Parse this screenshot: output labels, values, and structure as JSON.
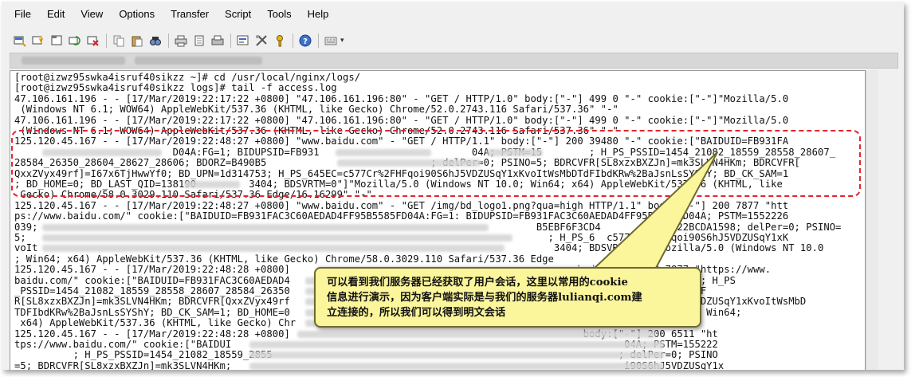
{
  "menu": {
    "file": "File",
    "edit": "Edit",
    "view": "View",
    "options": "Options",
    "transfer": "Transfer",
    "script": "Script",
    "tools": "Tools",
    "help": "Help"
  },
  "toolbar": {
    "icons": [
      "connect-icon",
      "quick-connect-icon",
      "connect-tab-icon",
      "reconnect-icon",
      "disconnect-icon",
      "copy-icon",
      "paste-icon",
      "find-icon",
      "print-setup-icon",
      "print-icon",
      "print-screen-icon",
      "session-options-icon",
      "global-options-icon",
      "key-map-icon",
      "help-icon",
      "map-keys-icon"
    ]
  },
  "terminal": {
    "lines": [
      "[root@izwz95swka4isruf40sikzz ~]# cd /usr/local/nginx/logs/",
      "[root@izwz95swka4isruf40sikzz logs]# tail -f access.log",
      "47.106.161.196 - - [17/Mar/2019:22:17:22 +0800] \"47.106.161.196:80\" - \"GET / HTTP/1.0\" body:[\"-\"] 499 0 \"-\" cookie:[\"-\"]\"Mozilla/5.0",
      " (Windows NT 6.1; WOW64) AppleWebKit/537.36 (KHTML, like Gecko) Chrome/52.0.2743.116 Safari/537.36\" \"-\"",
      "47.106.161.196 - - [17/Mar/2019:22:17:22 +0800] \"47.106.161.196:80\" - \"GET / HTTP/1.0\" body:[\"-\"] 499 0 \"-\" cookie:[\"-\"]\"Mozilla/5.0",
      " (Windows NT 6.1; WOW64) AppleWebKit/537.36 (KHTML, like Gecko) Chrome/52.0.2743.116 Safari/537.36\" \"-\"",
      "125.120.45.167 - - [17/Mar/2019:22:48:27 +0800] \"www.baidu.com\" - \"GET / HTTP/1.1\" body:[\"-\"] 200 39480 \"-\" cookie:[\"BAIDUID=FB931FA",
      "                           D04A:FG=1; BIDUPSID=FB931                          04A; PSTM=15        ; H_PS_PSSID=1454_21082_18559_28558_28607_",
      "28584_26350_28604_28627_28606; BDORZ=B490B5                            ; delPer=0; PSINO=5; BDRCVFR[SL8xzxBXZJn]=mk3SLVN4HKm; BDRCVFR[",
      "QxxZVyx49rf]=I67x6TjHwwYf0; BD_UPN=1d314753; H_PS_645EC=c577Cr%2FHFqoi90S6hJ5VDZUSqY1xKvoItWsMbDTdFIbdKRw%2BaJsnLsSYShY; BD_CK_SAM=1",
      "; BD_HOME=0; BD_LAST_QID=138190         3404; BDSVRTM=0\"]\"Mozilla/5.0 (Windows NT 10.0; Win64; x64) AppleWebKit/537.36 (KHTML, like",
      " Gecko) Chrome/58.0.3029.110 Safari/537.36 Edge/16.16299\" \"-\"",
      "125.120.45.167 - - [17/Mar/2019:22:48:27 +0800] \"www.baidu.com\" - \"GET /img/bd_logo1.png?qua=high HTTP/1.1\" body:[\"-\"] 200 7877 \"htt",
      "ps://www.baidu.com/\" cookie:[\"BAIDUID=FB931FAC3C60AEDAD4FF95B5585FD04A:FG=1: BIDUPSID=FB931FAC3C60AEDAD4FF95B5585FD04A; PSTM=1552226",
      "039;                                                                                     B5EBF6F3CD4           5D22BCDA1598; delPer=0; PSINO=",
      "5;                                                                                         ; H_PS_6  c577Cr%2FHFqoi90S6hJ5VDZUSqY1xK",
      "voIt                                                                                        3404; BDSVRTM=0\"]\"Mozilla/5.0 (Windows NT 10.0",
      "; Win64; x64) AppleWebKit/537.36 (KHTML, like Gecko) Chrome/58.0.3029.110 Safari/537.36 Edge         99\" \"-\"",
      "125.120.45.167 - - [17/Mar/2019:22:48:28 +0800]                                                 body:[\"-\"] 200 7877 \"https://www.",
      "baidu.com/\" cookie:[\"BAIDUID=FB931FAC3C60AEDAD4                                                  PSTM=1552           ; H_PS",
      "_PSSID=1454_21082_18559_28558_28607_28584_26350                                                      ; PSINO=5; BDRCVF",
      "R[SL8xzxBXZJn]=mk3SLVN4HKm; BDRCVFR[QxxZVyx49rf                                                      %2FHFqoi90S6hJ5VDZUSqY1xKvoItWsMbD",
      "TDFIbdKRw%2BaJsnLsSYShY; BD_CK_SAM=1; BD_HOME=0                                                      Windows NT 10.0; Win64;",
      " x64) AppleWebKit/537.36 (KHTML, like Gecko) Chr",
      "125.120.45.167 - - [17/Mar/2019:22:48:28 +0800]                                                  body:[\"-\"] 200 6511 \"ht",
      "tps://www.baidu.com/\" cookie:[\"BAIDUI                                                                   04A; PSTM=155222",
      "          ; H_PS_PSSID=1454_21082_18559_2855                                                           ; delPer=0; PSINO",
      "=5; BDRCVFR[SL8xzxBXZJn]=mk3SLVN4HKm;                                                                   i90S6hJ5VDZUSqY1x"
    ]
  },
  "callout": {
    "line1": "可以看到我们服务器已经获取了用户会话，这里以常用的cookie",
    "line2": "信息进行演示，因为客户端实际是与我们的服务器lulianqi.com建",
    "line3": "立连接的，所以我们可以得到明文会话"
  }
}
